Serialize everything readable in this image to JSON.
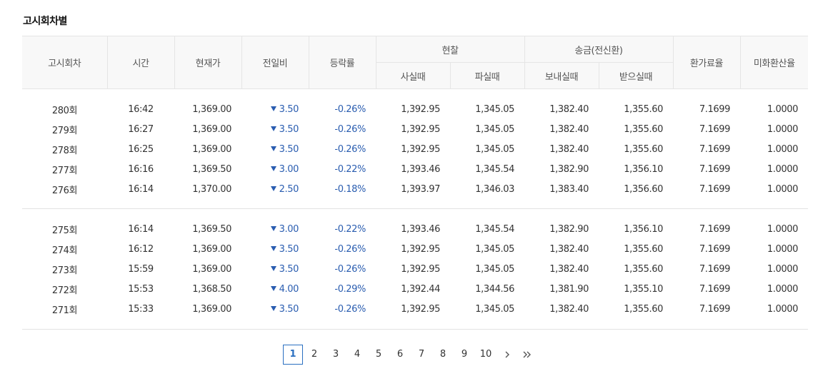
{
  "section_title": "고시회차별",
  "headers": {
    "round": "고시회차",
    "time": "시간",
    "price": "현재가",
    "change": "전일비",
    "rate": "등락률",
    "cash": "현찰",
    "cash_buy": "사실때",
    "cash_sell": "파실때",
    "wire": "송금(전신환)",
    "wire_send": "보내실때",
    "wire_receive": "받으실때",
    "conversion": "환가료율",
    "usd_rate": "미화환산율"
  },
  "rows": [
    {
      "round": "280회",
      "time": "16:42",
      "price": "1,369.00",
      "change": "3.50",
      "rate": "-0.26%",
      "cash_buy": "1,392.95",
      "cash_sell": "1,345.05",
      "wire_send": "1,382.40",
      "wire_receive": "1,355.60",
      "conversion": "7.1699",
      "usd_rate": "1.0000"
    },
    {
      "round": "279회",
      "time": "16:27",
      "price": "1,369.00",
      "change": "3.50",
      "rate": "-0.26%",
      "cash_buy": "1,392.95",
      "cash_sell": "1,345.05",
      "wire_send": "1,382.40",
      "wire_receive": "1,355.60",
      "conversion": "7.1699",
      "usd_rate": "1.0000"
    },
    {
      "round": "278회",
      "time": "16:25",
      "price": "1,369.00",
      "change": "3.50",
      "rate": "-0.26%",
      "cash_buy": "1,392.95",
      "cash_sell": "1,345.05",
      "wire_send": "1,382.40",
      "wire_receive": "1,355.60",
      "conversion": "7.1699",
      "usd_rate": "1.0000"
    },
    {
      "round": "277회",
      "time": "16:16",
      "price": "1,369.50",
      "change": "3.00",
      "rate": "-0.22%",
      "cash_buy": "1,393.46",
      "cash_sell": "1,345.54",
      "wire_send": "1,382.90",
      "wire_receive": "1,356.10",
      "conversion": "7.1699",
      "usd_rate": "1.0000"
    },
    {
      "round": "276회",
      "time": "16:14",
      "price": "1,370.00",
      "change": "2.50",
      "rate": "-0.18%",
      "cash_buy": "1,393.97",
      "cash_sell": "1,346.03",
      "wire_send": "1,383.40",
      "wire_receive": "1,356.60",
      "conversion": "7.1699",
      "usd_rate": "1.0000"
    },
    {
      "round": "275회",
      "time": "16:14",
      "price": "1,369.50",
      "change": "3.00",
      "rate": "-0.22%",
      "cash_buy": "1,393.46",
      "cash_sell": "1,345.54",
      "wire_send": "1,382.90",
      "wire_receive": "1,356.10",
      "conversion": "7.1699",
      "usd_rate": "1.0000"
    },
    {
      "round": "274회",
      "time": "16:12",
      "price": "1,369.00",
      "change": "3.50",
      "rate": "-0.26%",
      "cash_buy": "1,392.95",
      "cash_sell": "1,345.05",
      "wire_send": "1,382.40",
      "wire_receive": "1,355.60",
      "conversion": "7.1699",
      "usd_rate": "1.0000"
    },
    {
      "round": "273회",
      "time": "15:59",
      "price": "1,369.00",
      "change": "3.50",
      "rate": "-0.26%",
      "cash_buy": "1,392.95",
      "cash_sell": "1,345.05",
      "wire_send": "1,382.40",
      "wire_receive": "1,355.60",
      "conversion": "7.1699",
      "usd_rate": "1.0000"
    },
    {
      "round": "272회",
      "time": "15:53",
      "price": "1,368.50",
      "change": "4.00",
      "rate": "-0.29%",
      "cash_buy": "1,392.44",
      "cash_sell": "1,344.56",
      "wire_send": "1,381.90",
      "wire_receive": "1,355.10",
      "conversion": "7.1699",
      "usd_rate": "1.0000"
    },
    {
      "round": "271회",
      "time": "15:33",
      "price": "1,369.00",
      "change": "3.50",
      "rate": "-0.26%",
      "cash_buy": "1,392.95",
      "cash_sell": "1,345.05",
      "wire_send": "1,382.40",
      "wire_receive": "1,355.60",
      "conversion": "7.1699",
      "usd_rate": "1.0000"
    }
  ],
  "change_icon": "down-triangle-icon",
  "change_color": "#2a5db0",
  "pagination": {
    "pages": [
      "1",
      "2",
      "3",
      "4",
      "5",
      "6",
      "7",
      "8",
      "9",
      "10"
    ],
    "current": "1",
    "next_icon": "chevron-right-icon",
    "last_icon": "double-chevron-right-icon"
  }
}
